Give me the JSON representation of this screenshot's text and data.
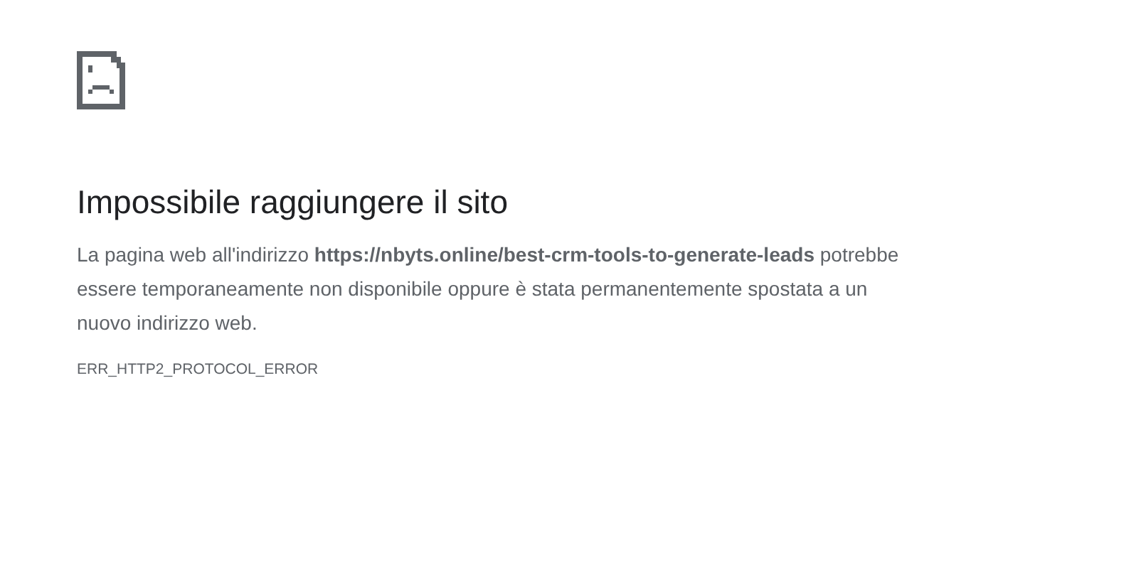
{
  "error_page": {
    "title": "Impossibile raggiungere il sito",
    "message": "La pagina web all'indirizzo **https://nbyts.online/best-crm-tools-to-generate-leads** potrebbe essere temporaneamente non disponibile oppure è stata permanentemente spostata a un nuovo indirizzo web.",
    "error_code": "ERR_HTTP2_PROTOCOL_ERROR"
  }
}
